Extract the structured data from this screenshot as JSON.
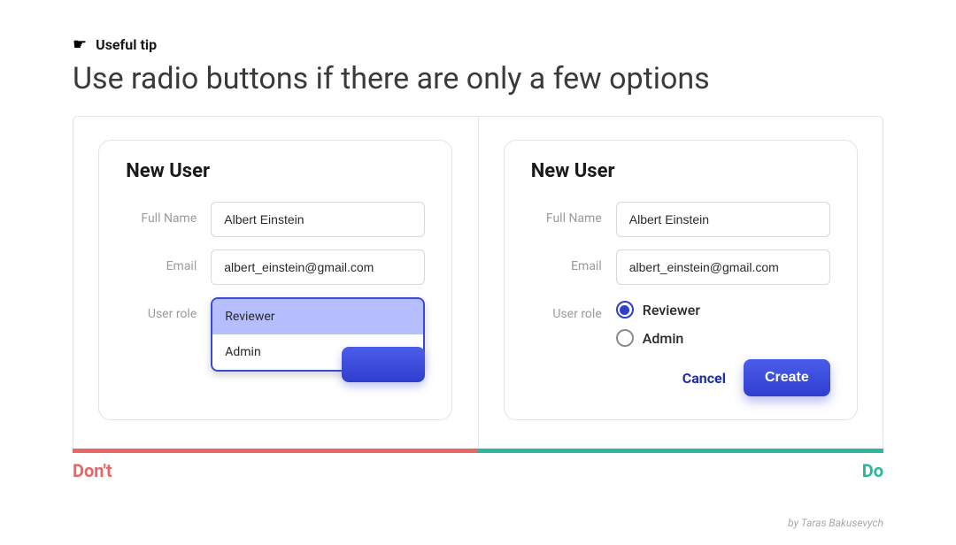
{
  "tip": {
    "label": "Useful tip",
    "icon": "👉"
  },
  "headline": "Use radio buttons if there are only a few options",
  "left": {
    "card_title": "New User",
    "full_name_label": "Full Name",
    "full_name_value": "Albert Einstein",
    "email_label": "Email",
    "email_value": "albert_einstein@gmail.com",
    "role_label": "User role",
    "dropdown": {
      "option1": "Reviewer",
      "option2": "Admin"
    }
  },
  "right": {
    "card_title": "New User",
    "full_name_label": "Full Name",
    "full_name_value": "Albert Einstein",
    "email_label": "Email",
    "email_value": "albert_einstein@gmail.com",
    "role_label": "User role",
    "radio_reviewer": "Reviewer",
    "radio_admin": "Admin",
    "cancel": "Cancel",
    "create": "Create"
  },
  "bottom": {
    "dont": "Don't",
    "do": "Do"
  },
  "credit": "by Taras Bakusevych"
}
